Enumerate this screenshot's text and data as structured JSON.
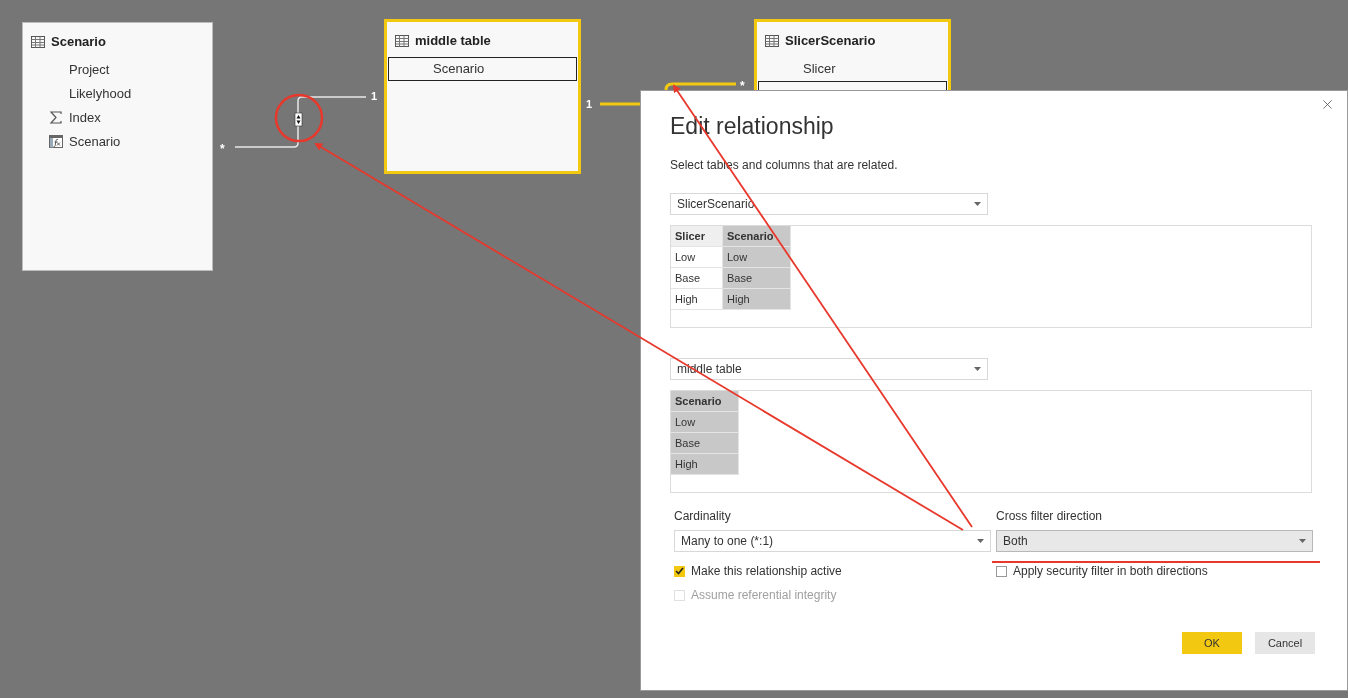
{
  "diagram": {
    "tables": [
      {
        "name": "Scenario",
        "selected": false,
        "fields": [
          {
            "name": "Project",
            "kind": "column",
            "selected": false
          },
          {
            "name": "Likelyhood",
            "kind": "column",
            "selected": false
          },
          {
            "name": "Index",
            "kind": "sum",
            "selected": false
          },
          {
            "name": "Scenario",
            "kind": "calculated",
            "selected": false
          }
        ]
      },
      {
        "name": "middle table",
        "selected": true,
        "fields": [
          {
            "name": "Scenario",
            "kind": "column",
            "selected": true
          }
        ]
      },
      {
        "name": "SlicerScenario",
        "selected": true,
        "fields": [
          {
            "name": "Slicer",
            "kind": "column",
            "selected": false
          },
          {
            "kind": "column",
            "selected": true
          }
        ]
      }
    ],
    "relationships": [
      {
        "from_label": "*",
        "to_label": "1",
        "selected": false
      },
      {
        "from_label": "1",
        "to_label": "*",
        "selected": true
      }
    ]
  },
  "dialog": {
    "title": "Edit relationship",
    "subtitle": "Select tables and columns that are related.",
    "tables": [
      {
        "value": "SlicerScenario",
        "columns": [
          {
            "name": "Slicer",
            "selected": false
          },
          {
            "name": "Scenario",
            "selected": true
          }
        ],
        "rows": [
          [
            "Low",
            "Low"
          ],
          [
            "Base",
            "Base"
          ],
          [
            "High",
            "High"
          ]
        ]
      },
      {
        "value": "middle table",
        "columns": [
          {
            "name": "Scenario",
            "selected": true
          }
        ],
        "rows": [
          [
            "Low"
          ],
          [
            "Base"
          ],
          [
            "High"
          ]
        ]
      }
    ],
    "cardinality": {
      "label": "Cardinality",
      "value": "Many to one (*:1)",
      "focused": false
    },
    "cross_filter": {
      "label": "Cross filter direction",
      "value": "Both",
      "focused": true
    },
    "checkboxes": [
      {
        "label": "Make this relationship active",
        "checked": true,
        "disabled": false
      },
      {
        "label": "Apply security filter in both directions",
        "checked": false,
        "disabled": false
      },
      {
        "label": "Assume referential integrity",
        "checked": false,
        "disabled": true
      }
    ],
    "buttons": [
      {
        "label": "OK",
        "kind": "primary"
      },
      {
        "label": "Cancel",
        "kind": "secondary"
      }
    ]
  }
}
